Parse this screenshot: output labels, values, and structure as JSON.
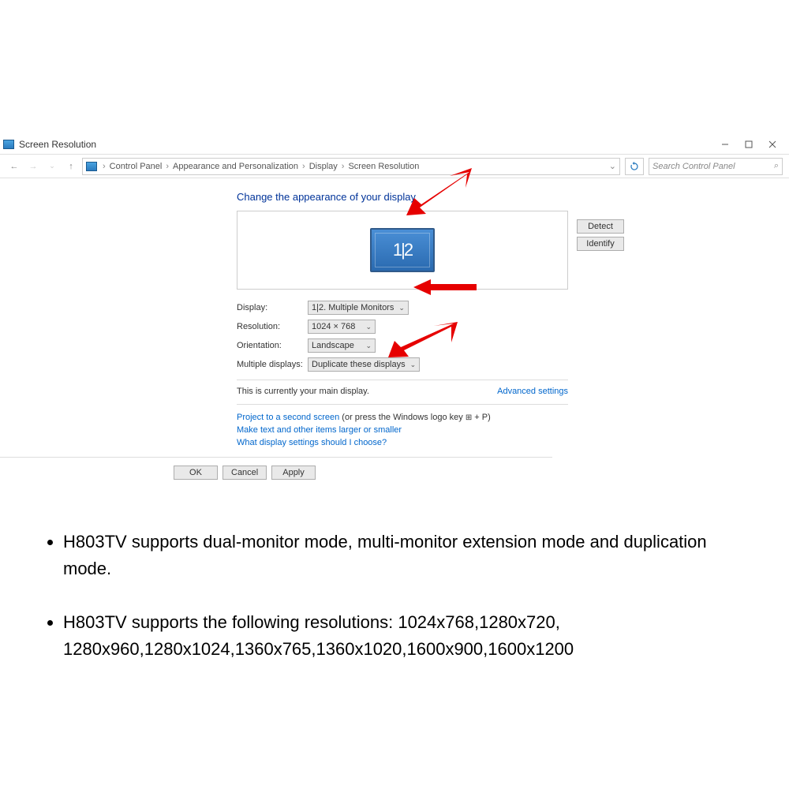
{
  "window": {
    "title": "Screen Resolution"
  },
  "breadcrumbs": {
    "root": "Control Panel",
    "cat": "Appearance and Personalization",
    "sub": "Display",
    "leaf": "Screen Resolution"
  },
  "search": {
    "placeholder": "Search Control Panel"
  },
  "header": {
    "title": "Change the appearance of your display"
  },
  "monitor": {
    "label": "1|2"
  },
  "buttons": {
    "detect": "Detect",
    "identify": "Identify",
    "ok": "OK",
    "cancel": "Cancel",
    "apply": "Apply"
  },
  "form": {
    "display_label": "Display:",
    "display_value": "1|2. Multiple Monitors",
    "resolution_label": "Resolution:",
    "resolution_value": "1024 × 768",
    "orientation_label": "Orientation:",
    "orientation_value": "Landscape",
    "multiple_label": "Multiple displays:",
    "multiple_value": "Duplicate these displays"
  },
  "status": {
    "main_display": "This is currently your main display.",
    "advanced": "Advanced settings"
  },
  "links": {
    "project_link": "Project to a second screen",
    "project_suffix": " (or press the Windows logo key ",
    "project_suffix2": " + P)",
    "text_size": "Make text and other items larger or smaller",
    "which_settings": "What display settings should I choose?"
  },
  "bullets": {
    "b1": "H803TV supports dual-monitor mode, multi-monitor extension mode and duplication mode.",
    "b2": "H803TV supports the following resolutions: 1024x768,1280x720, 1280x960,1280x1024,1360x765,1360x1020,1600x900,1600x1200"
  }
}
